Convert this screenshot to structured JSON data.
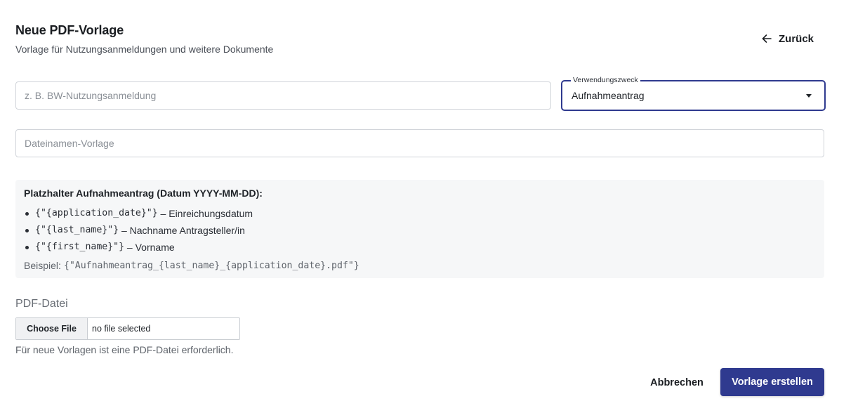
{
  "header": {
    "title": "Neue PDF-Vorlage",
    "subtitle": "Vorlage für Nutzungsanmeldungen und weitere Dokumente",
    "back_label": "Zurück",
    "back_icon": "arrow-left-icon"
  },
  "form": {
    "name_placeholder": "z. B. BW-Nutzungsanmeldung",
    "name_value": "",
    "purpose_label": "Verwendungszweck",
    "purpose_value": "Aufnahmeantrag",
    "filename_placeholder": "Dateinamen-Vorlage",
    "filename_value": ""
  },
  "placeholders": {
    "title": "Platzhalter Aufnahmeantrag (Datum YYYY-MM-DD):",
    "items": [
      {
        "code": "{\"{application_date}\"}",
        "desc": " – Einreichungsdatum"
      },
      {
        "code": "{\"{last_name}\"}",
        "desc": " – Nachname Antragsteller/in"
      },
      {
        "code": "{\"{first_name}\"}",
        "desc": " – Vorname"
      }
    ],
    "example_label": "Beispiel:",
    "example_code": "{\"Aufnahmeantrag_{last_name}_{application_date}.pdf\"}"
  },
  "pdf": {
    "label": "PDF-Datei",
    "choose_label": "Choose File",
    "status": "no file selected",
    "hint": "Für neue Vorlagen ist eine PDF-Datei erforderlich."
  },
  "actions": {
    "cancel_label": "Abbrechen",
    "submit_label": "Vorlage erstellen"
  },
  "colors": {
    "accent": "#2f3a8f",
    "info_bg": "#f6f7f8"
  }
}
